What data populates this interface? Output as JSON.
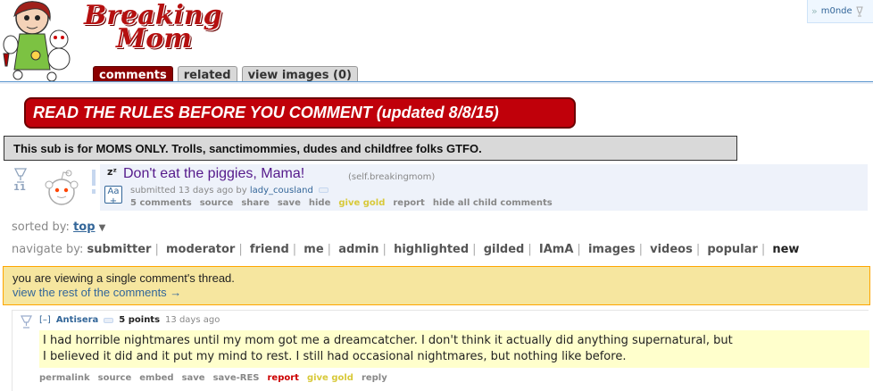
{
  "header": {
    "logo_line1": "Breaking",
    "logo_line2": "Mom",
    "tabs": [
      "comments",
      "related",
      "view images (0)"
    ],
    "user": "m0nde"
  },
  "banners": {
    "rules": "READ THE RULES BEFORE YOU COMMENT (updated 8/8/15)",
    "moms_only": "This sub is for MOMS ONLY. Trolls, sanctimommies, dudes and childfree folks GTFO."
  },
  "post": {
    "score": "11",
    "zz": "zᶻ",
    "title": "Don't eat the piggies, Mama!",
    "domain": "(self.breakingmom)",
    "submitted_prefix": "submitted 13 days ago by",
    "author": "lady_cousland",
    "self_icon_label": "Aa",
    "buttons": [
      "5 comments",
      "source",
      "share",
      "save",
      "hide",
      "give gold",
      "report",
      "hide all child comments"
    ]
  },
  "sort": {
    "label": "sorted by:",
    "value": "top"
  },
  "navigate": {
    "label": "navigate by:",
    "items": [
      "submitter",
      "moderator",
      "friend",
      "me",
      "admin",
      "highlighted",
      "gilded",
      "IAmA",
      "images",
      "videos",
      "popular",
      "new"
    ]
  },
  "infobar": {
    "line1": "you are viewing a single comment's thread.",
    "line2": "view the rest of the comments →"
  },
  "comment": {
    "expand": "[–]",
    "author": "Antisera",
    "points": "5 points",
    "time": "13 days ago",
    "body_line1": "I had horrible nightmares until my mom got me a dreamcatcher. I don't think it actually did anything supernatural, but",
    "body_line2": "I believed it did and it put my mind to rest. I still had occasional nightmares, but nothing like before.",
    "buttons": [
      "permalink",
      "source",
      "embed",
      "save",
      "save-RES",
      "report",
      "give gold",
      "reply"
    ]
  },
  "colors": {
    "brand_red": "#c0000a",
    "link_blue": "#336699",
    "infobar_bg": "#f6e69f",
    "highlight_bg": "#ffffcc"
  }
}
